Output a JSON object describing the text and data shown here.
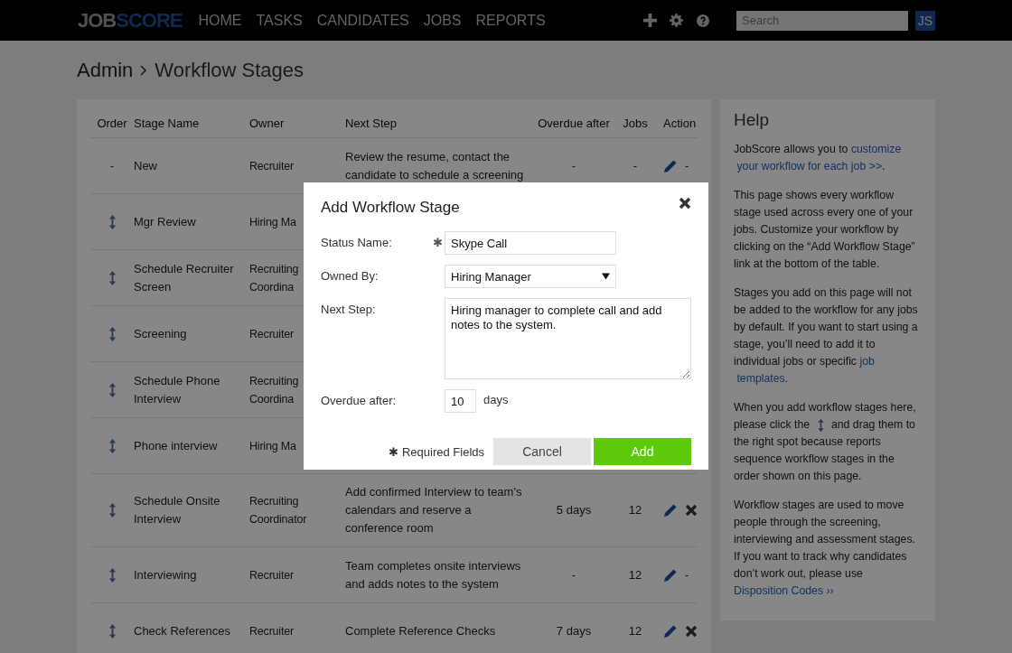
{
  "header": {
    "logo": {
      "part_1": "JOB",
      "part_2": "SCORE"
    },
    "nav": [
      {
        "label": "HOME"
      },
      {
        "label": "TASKS"
      },
      {
        "label": "CANDIDATES"
      },
      {
        "label": "JOBS"
      },
      {
        "label": "REPORTS"
      }
    ],
    "search": {
      "placeholder": "Search"
    },
    "avatar": "JS"
  },
  "breadcrumb": {
    "parent": "Admin",
    "current": "Workflow Stages"
  },
  "table": {
    "columns": [
      "Order",
      "Stage Name",
      "Owner",
      "Next Step",
      "Overdue after",
      "Jobs",
      "Action"
    ],
    "rows": [
      {
        "order": "-",
        "draggable": false,
        "stage": "New",
        "owner": "Recruiter",
        "next_step": "Review the resume, contact the candidate to schedule a screening",
        "overdue": "-",
        "jobs": "-",
        "editable": true,
        "delete": {
          "kind": "text",
          "text": "-"
        }
      },
      {
        "draggable": true,
        "stage": "Mgr Review",
        "owner": "Hiring Ma"
      },
      {
        "draggable": true,
        "stage": "Schedule Recruiter Screen",
        "owner": "Recruiting Coordina"
      },
      {
        "draggable": true,
        "stage": "Screening",
        "owner": "Recruiter"
      },
      {
        "draggable": true,
        "stage": "Schedule Phone Interview",
        "owner": "Recruiting Coordina"
      },
      {
        "draggable": true,
        "stage": "Phone interview",
        "owner": "Hiring Ma"
      },
      {
        "draggable": true,
        "stage": "Schedule Onsite Interview",
        "owner": "Recruiting Coordinator",
        "next_step": "Add confirmed Interview to team's calendars and reserve a conference room",
        "overdue": "5 days",
        "jobs": "12",
        "editable": true,
        "delete": {
          "kind": "icon"
        }
      },
      {
        "draggable": true,
        "stage": "Interviewing",
        "owner": "Recruiter",
        "next_step": "Team completes onsite interviews and adds notes to the system",
        "overdue": "-",
        "jobs": "12",
        "editable": true,
        "delete": {
          "kind": "text",
          "text": "-"
        }
      },
      {
        "draggable": true,
        "stage": "Check References",
        "owner": "Recruiter",
        "next_step": "Complete Reference Checks",
        "overdue": "7 days",
        "jobs": "12",
        "editable": true,
        "delete": {
          "kind": "icon"
        }
      }
    ]
  },
  "help": {
    "title": "Help",
    "paragraphs": [
      [
        {
          "kind": "text",
          "text": "JobScore allows you to "
        },
        {
          "kind": "link",
          "text": "customize"
        },
        {
          "kind": "link",
          "text": "your workflow for each job >>"
        },
        {
          "kind": "text",
          "text": "."
        }
      ],
      [
        {
          "kind": "text",
          "text": "This page shows every workflow stage used across every one of your jobs. Customize your workflow by clicking on the “Add Workflow Stage” link at the bottom of the table."
        }
      ],
      [
        {
          "kind": "text",
          "text": "Stages you add on this page will not be added to the workflow for any jobs by default. If you want to start using a stage, you’ll need to add it to individual jobs or specific "
        },
        {
          "kind": "link",
          "text": "job"
        },
        {
          "kind": "link",
          "text": "templates"
        },
        {
          "kind": "text",
          "text": "."
        }
      ],
      [
        {
          "kind": "text",
          "text": "When you add workflow stages here, please click the "
        },
        {
          "kind": "icon"
        },
        {
          "kind": "text",
          "text": " and drag them to the right spot because reports sequence workflow stages in the order shown on this page."
        }
      ],
      [
        {
          "kind": "text",
          "text": "Workflow stages are used to move people through the screening, interviewing and assessment stages. If you want to track why candidates don’t work out, please use "
        },
        {
          "kind": "link",
          "text": "Disposition Codes ››"
        }
      ]
    ]
  },
  "modal": {
    "title": "Add Workflow Stage",
    "required_mark": "✱",
    "fields": [
      {
        "kind": "text",
        "label": "Status Name:",
        "required": true,
        "value": "Skype Call"
      },
      {
        "kind": "select",
        "label": "Owned By:",
        "required": false,
        "value": "Hiring Manager"
      },
      {
        "kind": "textarea",
        "label": "Next Step:",
        "required": false,
        "value": "Hiring manager to complete call and add notes to the system."
      },
      {
        "kind": "number",
        "label": "Overdue after:",
        "required": false,
        "value": "10",
        "unit": "days"
      }
    ],
    "required_note": "✱ Required Fields",
    "buttons": [
      {
        "kind": "secondary",
        "label": "Cancel"
      },
      {
        "kind": "primary",
        "label": "Add"
      }
    ]
  }
}
